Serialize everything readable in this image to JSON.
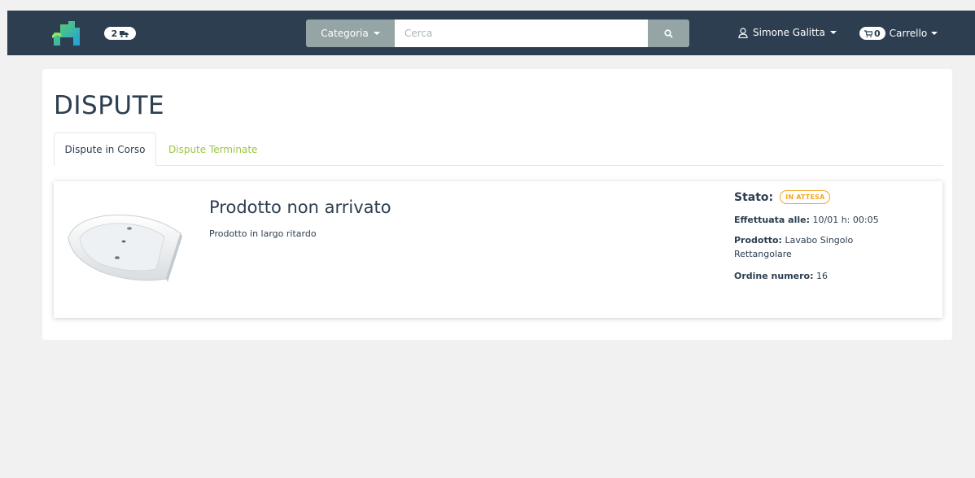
{
  "header": {
    "delivery_count": "2",
    "category_label": "Categoria",
    "search_placeholder": "Cerca",
    "user_name": "Simone Galitta",
    "cart_count": "0",
    "cart_label": "Carrello"
  },
  "page": {
    "title": "DISPUTE",
    "tabs": [
      {
        "label": "Dispute in Corso",
        "active": true
      },
      {
        "label": "Dispute Terminate",
        "active": false
      }
    ]
  },
  "dispute": {
    "title": "Prodotto non arrivato",
    "description": "Prodotto in largo ritardo",
    "stato_label": "Stato:",
    "stato_value": "IN ATTESA",
    "date_label": "Effettuata alle:",
    "date_value": "10/01 h: 00:05",
    "product_label": "Prodotto:",
    "product_value": "Lavabo Singolo Rettangolare",
    "order_label": "Ordine numero:",
    "order_value": "16"
  },
  "colors": {
    "navbar": "#2c3e50",
    "accent_green": "#9bc53d",
    "status_orange": "#f5a623",
    "button_gray": "#95a5a6"
  },
  "icons": {
    "logo": "house-logo-icon",
    "delivery": "truck-icon",
    "search": "search-icon",
    "user": "user-icon",
    "cart": "cart-icon"
  }
}
